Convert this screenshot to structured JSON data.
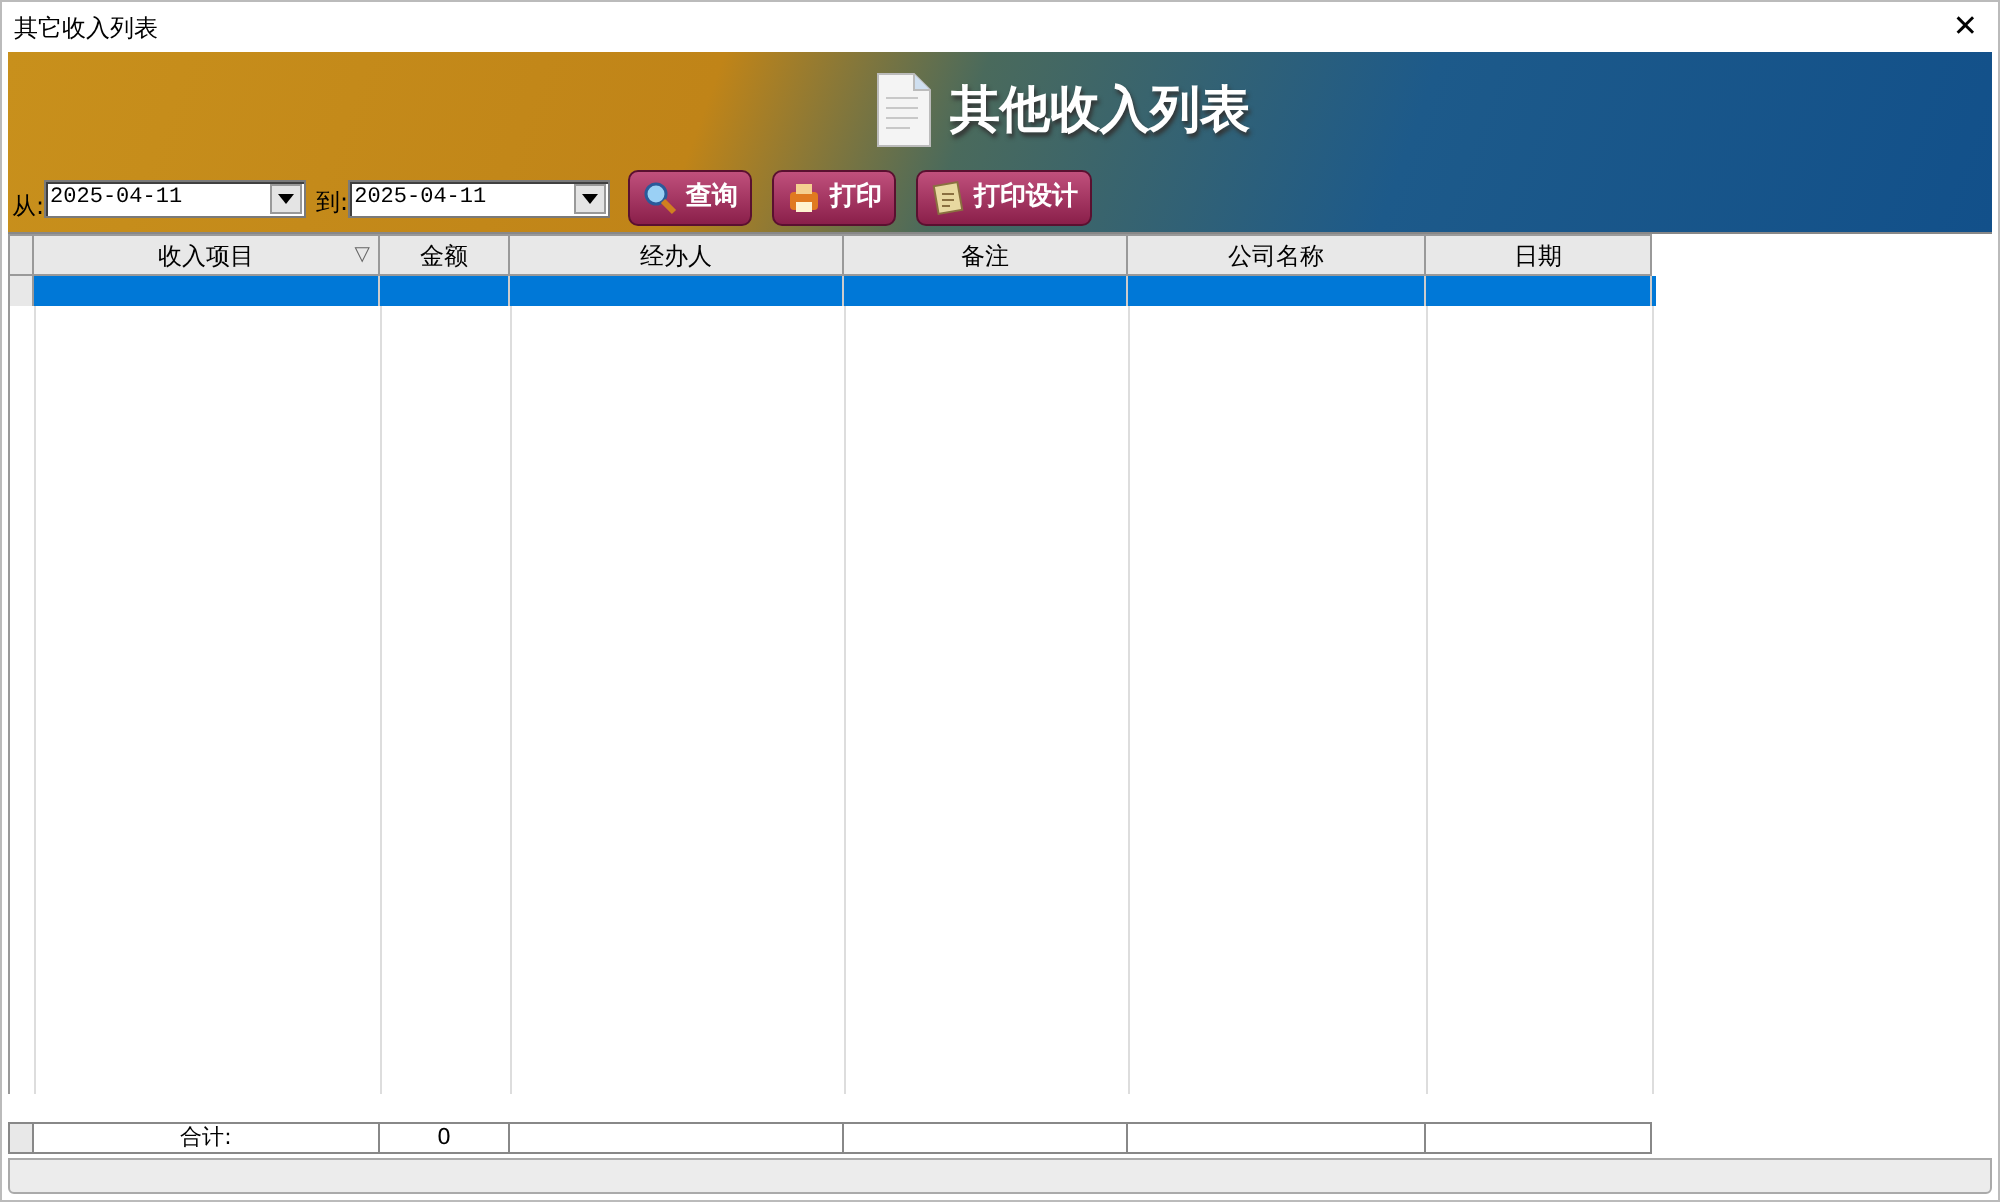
{
  "window": {
    "title": "其它收入列表",
    "close": "✕"
  },
  "banner": {
    "title": "其他收入列表"
  },
  "filter": {
    "from_label": "从:",
    "from_date": "2025-04-11",
    "to_label": "到:",
    "to_date": "2025-04-11"
  },
  "buttons": [
    {
      "label": "查询",
      "kind": "search"
    },
    {
      "label": "打印",
      "kind": "print"
    },
    {
      "label": "打印设计",
      "kind": "design"
    }
  ],
  "table": {
    "columns": [
      {
        "label": "收入项目",
        "sort_mark": "▽"
      },
      {
        "label": "金额"
      },
      {
        "label": "经办人"
      },
      {
        "label": "备注"
      },
      {
        "label": "公司名称"
      },
      {
        "label": "日期"
      }
    ],
    "rows": [
      {
        "selected": true
      }
    ],
    "footer": [
      "合计:",
      "0"
    ]
  }
}
